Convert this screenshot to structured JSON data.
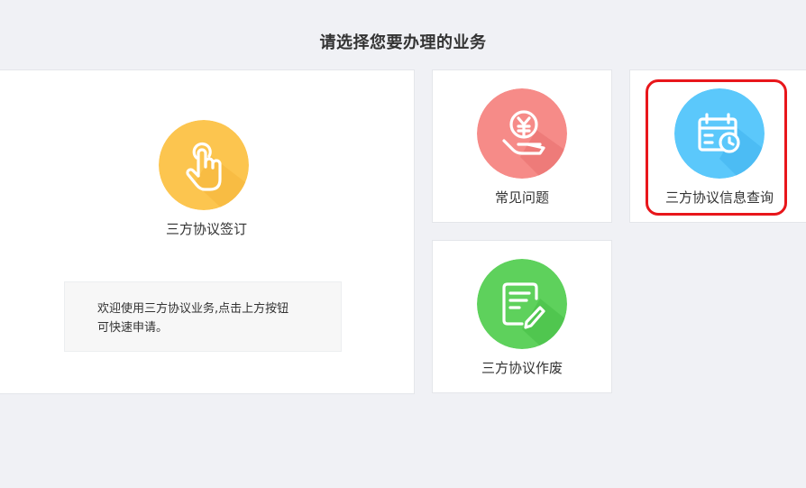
{
  "header": {
    "title": "请选择您要办理的业务"
  },
  "cards": {
    "sign": {
      "label": "三方协议签订",
      "icon": "tap-finger-icon",
      "color": "#fcc54f"
    },
    "faq": {
      "label": "常见问题",
      "icon": "yuan-hand-icon",
      "color": "#f68b88"
    },
    "query": {
      "label": "三方协议信息查询",
      "icon": "calendar-clock-icon",
      "color": "#5bc8fb"
    },
    "void": {
      "label": "三方协议作废",
      "icon": "document-edit-icon",
      "color": "#5ed15c"
    }
  },
  "notice": {
    "line1": "欢迎使用三方协议业务,点击上方按钮",
    "line2": "可快速申请。"
  },
  "highlight": {
    "color": "#e8161b",
    "target": "三方协议信息查询"
  }
}
